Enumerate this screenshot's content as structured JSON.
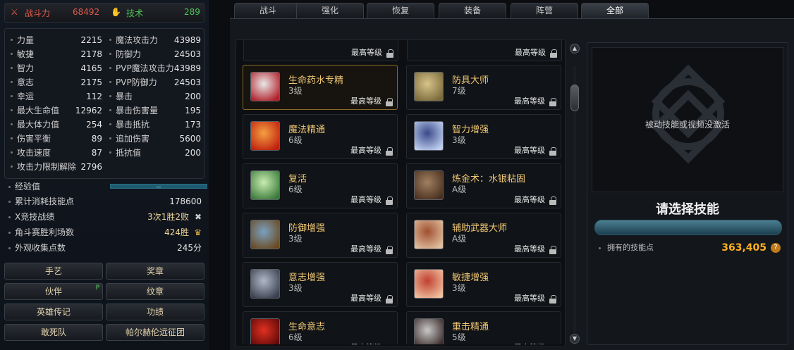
{
  "header": {
    "combat_label": "战斗力",
    "combat_value": "68492",
    "skill_label": "技术",
    "skill_value": "289"
  },
  "attributes_left": [
    {
      "label": "力量",
      "value": "2215"
    },
    {
      "label": "敏捷",
      "value": "2178"
    },
    {
      "label": "智力",
      "value": "4165"
    },
    {
      "label": "意志",
      "value": "2175"
    },
    {
      "label": "幸运",
      "value": "112"
    },
    {
      "label": "最大生命值",
      "value": "12962"
    },
    {
      "label": "最大体力值",
      "value": "254"
    },
    {
      "label": "伤害平衡",
      "value": "89"
    },
    {
      "label": "攻击速度",
      "value": "87"
    },
    {
      "label": "攻击力限制解除",
      "value": "2796"
    }
  ],
  "attributes_right": [
    {
      "label": "魔法攻击力",
      "value": "43989"
    },
    {
      "label": "防御力",
      "value": "24503"
    },
    {
      "label": "PVP魔法攻击力",
      "value": "43989"
    },
    {
      "label": "PVP防御力",
      "value": "24503"
    },
    {
      "label": "暴击",
      "value": "200"
    },
    {
      "label": "暴击伤害量",
      "value": "195"
    },
    {
      "label": "暴击抵抗",
      "value": "173"
    },
    {
      "label": "追加伤害",
      "value": "5600"
    },
    {
      "label": "抵抗值",
      "value": "200"
    }
  ],
  "stats": {
    "exp_label": "经验值",
    "exp_bar_text": "--",
    "skillpoints_label": "累计消耗技能点",
    "skillpoints_value": "178600",
    "arena_label": "X竞技战绩",
    "arena_value": "3次1胜2败",
    "duel_label": "角斗赛胜利场数",
    "duel_value": "424胜",
    "appearance_label": "外观收集点数",
    "appearance_value": "245分"
  },
  "left_buttons": [
    {
      "label": "手艺"
    },
    {
      "label": "奖章"
    },
    {
      "label": "伙伴",
      "badge": "P"
    },
    {
      "label": "纹章"
    },
    {
      "label": "英雄传记"
    },
    {
      "label": "功绩"
    },
    {
      "label": "敢死队"
    },
    {
      "label": "帕尔赫伦远征团"
    }
  ],
  "tabs": [
    "战斗",
    "强化",
    "恢复",
    "装备",
    "阵营",
    "全部"
  ],
  "active_tab": "全部",
  "max_level_label": "最高等级",
  "skills": [
    {
      "name": "生命药水专精",
      "level": "3级",
      "icon": "potion-icon",
      "selected": true
    },
    {
      "name": "防具大师",
      "level": "7级",
      "icon": "armor-icon"
    },
    {
      "name": "魔法精通",
      "level": "6级",
      "icon": "magic-icon"
    },
    {
      "name": "智力增强",
      "level": "3级",
      "icon": "brain-icon"
    },
    {
      "name": "复活",
      "level": "6级",
      "icon": "revive-icon"
    },
    {
      "name": "炼金术：水银粘固",
      "level": "A级",
      "icon": "alchemy-icon"
    },
    {
      "name": "防御增强",
      "level": "3级",
      "icon": "shield-icon"
    },
    {
      "name": "辅助武器大师",
      "level": "A级",
      "icon": "weapon-icon"
    },
    {
      "name": "意志增强",
      "level": "3级",
      "icon": "will-icon"
    },
    {
      "name": "敏捷增强",
      "level": "3级",
      "icon": "agility-icon"
    },
    {
      "name": "生命意志",
      "level": "6级",
      "icon": "life-icon"
    },
    {
      "name": "重击精通",
      "level": "5级",
      "icon": "strike-icon"
    }
  ],
  "detail": {
    "inactive_message": "被动技能或视频没激活",
    "select_prompt": "请选择技能",
    "points_label": "拥有的技能点",
    "points_value": "363,405",
    "help": "?"
  },
  "scroll": {
    "up": "▲",
    "down": "▼"
  },
  "colors": {
    "combat": "#e05a4e",
    "skill": "#4fc25a",
    "gold": "#f0c774",
    "points": "#ffb020"
  }
}
